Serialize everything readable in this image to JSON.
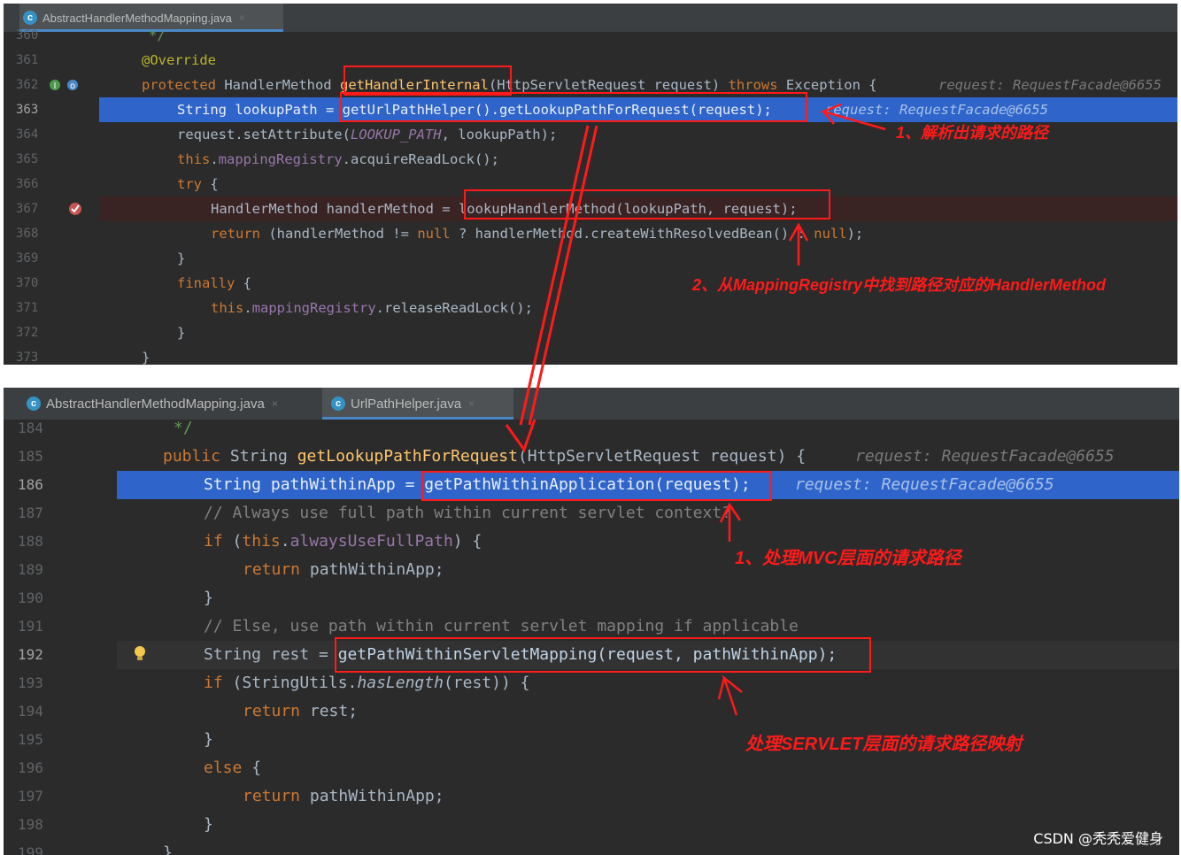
{
  "panel_top": {
    "tab": {
      "label": "AbstractHandlerMethodMapping.java",
      "icon": "class-file-icon",
      "close": "×"
    },
    "lines": [
      {
        "num": "360",
        "code": "*/"
      },
      {
        "num": "361",
        "code": "@Override"
      },
      {
        "num": "362",
        "code": "protected HandlerMethod getHandlerInternal(HttpServletRequest request) throws Exception {",
        "hint": "request: RequestFacade@6655"
      },
      {
        "num": "363",
        "code": "String lookupPath = getUrlPathHelper().getLookupPathForRequest(request);",
        "hint": "request: RequestFacade@6655"
      },
      {
        "num": "364",
        "code": "request.setAttribute(LOOKUP_PATH, lookupPath);"
      },
      {
        "num": "365",
        "code": "this.mappingRegistry.acquireReadLock();"
      },
      {
        "num": "366",
        "code": "try {"
      },
      {
        "num": "367",
        "code": "HandlerMethod handlerMethod = lookupHandlerMethod(lookupPath, request);"
      },
      {
        "num": "368",
        "code": "return (handlerMethod != null ? handlerMethod.createWithResolvedBean() : null);"
      },
      {
        "num": "369",
        "code": "}"
      },
      {
        "num": "370",
        "code": "finally {"
      },
      {
        "num": "371",
        "code": "this.mappingRegistry.releaseReadLock();"
      },
      {
        "num": "372",
        "code": "}"
      },
      {
        "num": "373",
        "code": "}"
      }
    ],
    "annotations": [
      "1、解析出请求的路径",
      "2、从MappingRegistry中找到路径对应的HandlerMethod"
    ]
  },
  "panel_bottom": {
    "tabs": [
      {
        "label": "AbstractHandlerMethodMapping.java",
        "icon": "class-file-icon",
        "close": "×"
      },
      {
        "label": "UrlPathHelper.java",
        "icon": "class-file-icon",
        "close": "×"
      }
    ],
    "lines": [
      {
        "num": "184",
        "code": "*/"
      },
      {
        "num": "185",
        "code": "public String getLookupPathForRequest(HttpServletRequest request) {",
        "hint": "request: RequestFacade@6655"
      },
      {
        "num": "186",
        "code": "String pathWithinApp = getPathWithinApplication(request);",
        "hint": "request: RequestFacade@6655"
      },
      {
        "num": "187",
        "code": "// Always use full path within current servlet context?"
      },
      {
        "num": "188",
        "code": "if (this.alwaysUseFullPath) {"
      },
      {
        "num": "189",
        "code": "return pathWithinApp;"
      },
      {
        "num": "190",
        "code": "}"
      },
      {
        "num": "191",
        "code": "// Else, use path within current servlet mapping if applicable"
      },
      {
        "num": "192",
        "code": "String rest = getPathWithinServletMapping(request, pathWithinApp);"
      },
      {
        "num": "193",
        "code": "if (StringUtils.hasLength(rest)) {"
      },
      {
        "num": "194",
        "code": "return rest;"
      },
      {
        "num": "195",
        "code": "}"
      },
      {
        "num": "196",
        "code": "else {"
      },
      {
        "num": "197",
        "code": "return pathWithinApp;"
      },
      {
        "num": "198",
        "code": "}"
      },
      {
        "num": "199",
        "code": "}"
      }
    ],
    "annotations": [
      "1、处理MVC层面的请求路径",
      "处理SERVLET层面的请求路径映射"
    ]
  },
  "watermark": "CSDN @秃秃爱健身",
  "colors": {
    "annotation": "#ff1a1a",
    "selection": "#2f65ca",
    "background": "#2b2b2b"
  }
}
